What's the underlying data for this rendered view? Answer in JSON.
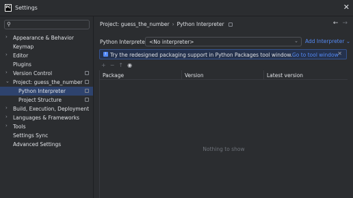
{
  "window": {
    "title": "Settings",
    "logo_text": "PC",
    "close_glyph": "✕"
  },
  "search": {
    "icon_glyph": "⚲",
    "placeholder": ""
  },
  "sidebar": {
    "items": [
      {
        "label": "Appearance & Behavior",
        "chevron": "›"
      },
      {
        "label": "Keymap",
        "chevron": ""
      },
      {
        "label": "Editor",
        "chevron": "›"
      },
      {
        "label": "Plugins",
        "chevron": ""
      },
      {
        "label": "Version Control",
        "chevron": "›"
      },
      {
        "label": "Project: guess_the_number",
        "chevron": "⌄"
      },
      {
        "label": "Python Interpreter",
        "chevron": ""
      },
      {
        "label": "Project Structure",
        "chevron": ""
      },
      {
        "label": "Build, Execution, Deployment",
        "chevron": "›"
      },
      {
        "label": "Languages & Frameworks",
        "chevron": "›"
      },
      {
        "label": "Tools",
        "chevron": "›"
      },
      {
        "label": "Settings Sync",
        "chevron": ""
      },
      {
        "label": "Advanced Settings",
        "chevron": ""
      }
    ]
  },
  "breadcrumb": {
    "project": "Project: guess_the_number",
    "separator": "›",
    "page": "Python Interpreter"
  },
  "nav": {
    "back": "←",
    "forward": "→"
  },
  "interpreter": {
    "label": "Python Interpreter:",
    "value": "<No interpreter>",
    "chevron": "⌄",
    "add_label": "Add Interpreter ⌄"
  },
  "banner": {
    "icon": "i",
    "text": "Try the redesigned packaging support in Python Packages tool window.",
    "link": "Go to tool window",
    "close": "✕"
  },
  "toolbar": {
    "add": "+",
    "remove": "−",
    "upgrade": "↑",
    "eye": "◉"
  },
  "table": {
    "columns": [
      "Package",
      "Version",
      "Latest version"
    ],
    "empty_text": "Nothing to show"
  },
  "colors": {
    "accent": "#548af7",
    "selection": "#2e436e",
    "background": "#2b2d30"
  }
}
